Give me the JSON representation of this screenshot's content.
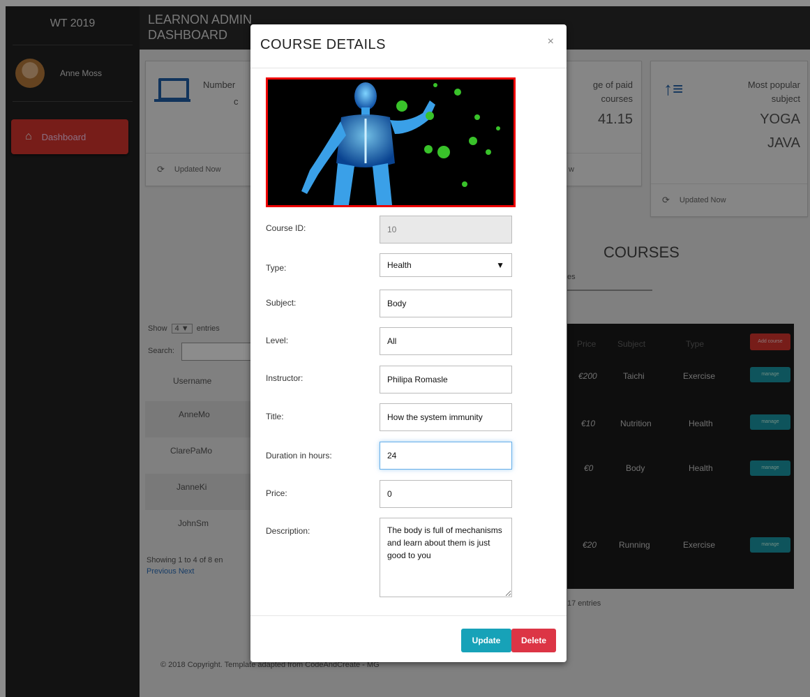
{
  "sidebar": {
    "brand": "WT 2019",
    "user_name": "Anne Moss",
    "dashboard_label": "Dashboard"
  },
  "header": {
    "title_line1": "LEARNON ADMIN",
    "title_line2": "DASHBOARD"
  },
  "cards": {
    "card1_label": "Number",
    "card1_label2": "c",
    "card1_updated": "Updated Now",
    "card3_label": "ge of paid",
    "card3_label2": "courses",
    "card3_value": "41.15",
    "card3_updated": "w",
    "card4_label": "Most popular",
    "card4_label2": "subject",
    "card4_value1": "YOGA",
    "card4_value2": "JAVA",
    "card4_updated": "Updated Now"
  },
  "background": {
    "courses_title": "COURSES",
    "courses_tab": "es",
    "show_label": "Show",
    "show_value": "4",
    "entries_label": "entries",
    "search_label": "Search:",
    "username_header": "Username",
    "users": [
      "AnneMo",
      "ClarePaMo",
      "JanneKi",
      "JohnSm"
    ],
    "showing": "Showing 1 to 4 of 8 en",
    "pager": "Previous Next",
    "entries_17": "17 entries",
    "footer": "© 2018 Copyright. Template adapted from CodeAndCreate - MG",
    "table_headers": [
      "Price",
      "Subject",
      "Type"
    ],
    "add_button": "Add course",
    "rows": [
      {
        "price": "€200",
        "subject": "Taichi",
        "type": "Exercise"
      },
      {
        "price": "€10",
        "subject": "Nutrition",
        "type": "Health"
      },
      {
        "price": "€0",
        "subject": "Body",
        "type": "Health"
      },
      {
        "price": "€20",
        "subject": "Running",
        "type": "Exercise"
      }
    ],
    "manage_label": "manage"
  },
  "modal": {
    "title": "COURSE DETAILS",
    "close": "×",
    "course_id_label": "Course ID:",
    "course_id": "10",
    "type_label": "Type:",
    "type_value": "Health",
    "subject_label": "Subject:",
    "subject_value": "Body",
    "level_label": "Level:",
    "level_value": "All",
    "instructor_label": "Instructor:",
    "instructor_value": "Philipa Romasle",
    "title_label": "Title:",
    "title_value": "How the system immunity",
    "duration_label": "Duration in hours:",
    "duration_value": "24",
    "price_label": "Price:",
    "price_value": "0",
    "description_label": "Description:",
    "description_value": "The body is full of mechanisms and learn about them is just good to you",
    "update_label": "Update",
    "delete_label": "Delete"
  }
}
